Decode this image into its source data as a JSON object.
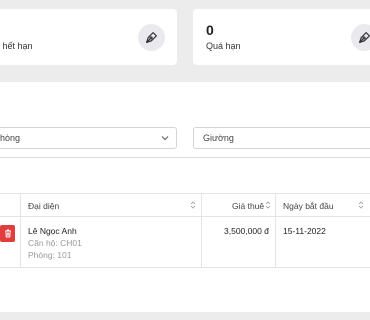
{
  "stats": [
    {
      "count": "",
      "label": "ắp hết hạn",
      "icon": "pen-nib-icon"
    },
    {
      "count": "0",
      "label": "Quá hạn",
      "icon": "pen-nib-icon"
    }
  ],
  "filters": {
    "room": "hòng",
    "bed": "Giường"
  },
  "table": {
    "headers": [
      "Đại diện",
      "Giá thuê",
      "Ngày bắt đầu"
    ],
    "rows": [
      {
        "name": "Lê Ngọc Anh",
        "apartment": "Căn hộ: CH01",
        "room": "Phòng: 101",
        "price": "3,500,000 đ",
        "start": "15-11-2022"
      }
    ]
  },
  "colors": {
    "background": "#ececec",
    "card": "#ffffff",
    "delete": "#e23d3d",
    "icon_bg": "#e9e9ee"
  }
}
